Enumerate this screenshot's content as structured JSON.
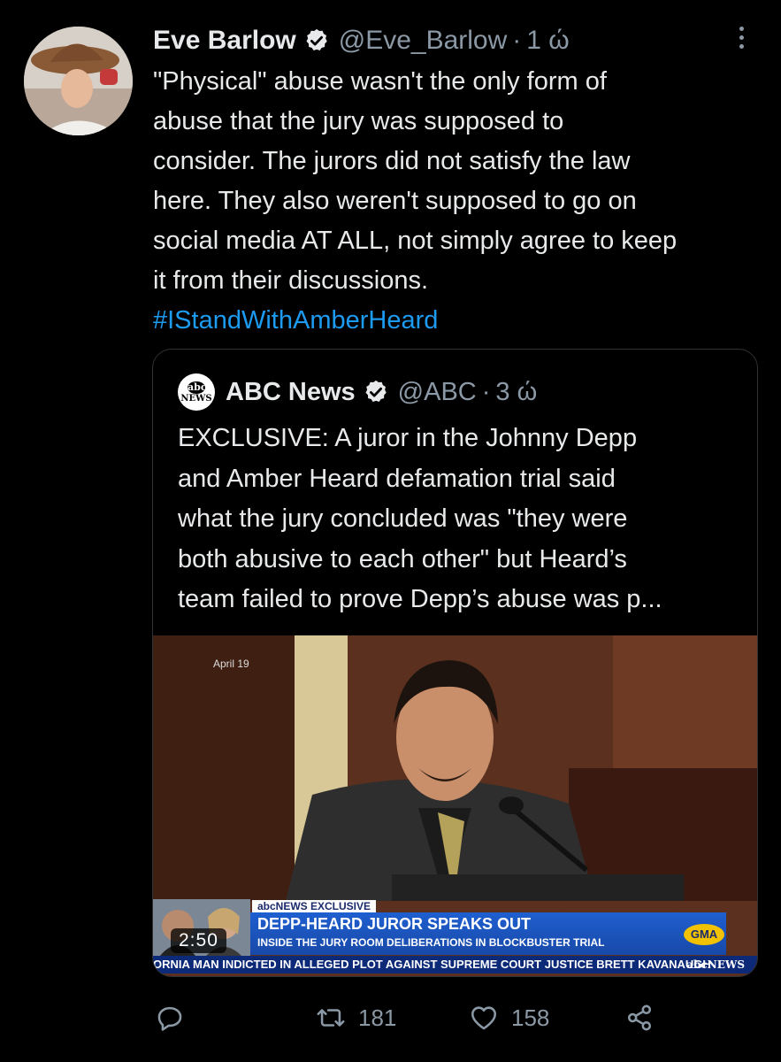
{
  "tweet": {
    "author_name": "Eve Barlow",
    "handle": "@Eve_Barlow",
    "separator": "·",
    "time": "1 ώ",
    "text_lines": [
      "\"Physical\" abuse wasn't the only form of",
      "abuse that the jury was supposed to",
      "consider. The jurors did not satisfy the law",
      "here. They also weren't supposed to go on",
      "social media AT ALL, not simply agree to keep",
      "it from their discussions."
    ],
    "hashtag": "#IStandWithAmberHeard"
  },
  "quoted": {
    "author_name": "ABC News",
    "handle": "@ABC",
    "separator": "·",
    "time": "3 ώ",
    "logo_top": "abc",
    "logo_bottom": "NEWS",
    "text_lines": [
      "EXCLUSIVE: A juror in the Johnny Depp",
      "and Amber Heard defamation trial said",
      "what the jury concluded was \"they were",
      "both abusive to each other\" but Heard’s",
      "team failed to prove Depp’s abuse was p..."
    ],
    "video": {
      "date_stamp": "April 19",
      "duration": "2:50",
      "tag": "abcNEWS EXCLUSIVE",
      "headline": "DEPP-HEARD JUROR SPEAKS OUT",
      "subheadline": "INSIDE THE JURY ROOM DELIBERATIONS IN BLOCKBUSTER TRIAL",
      "badge": "GMA",
      "ticker": "ORNIA MAN INDICTED IN ALLEGED PLOT AGAINST SUPREME COURT JUSTICE BRETT KAVANAUGH",
      "ticker_brand": "abcNEWS"
    }
  },
  "actions": {
    "reply_icon": "reply-icon",
    "retweet_icon": "retweet-icon",
    "retweets": "181",
    "like_icon": "heart-icon",
    "likes": "158",
    "share_icon": "share-icon"
  },
  "colors": {
    "background": "#000000",
    "text": "#e7e9ea",
    "secondary": "#8b98a5",
    "link": "#1d9bf0",
    "border": "#2f3336"
  }
}
